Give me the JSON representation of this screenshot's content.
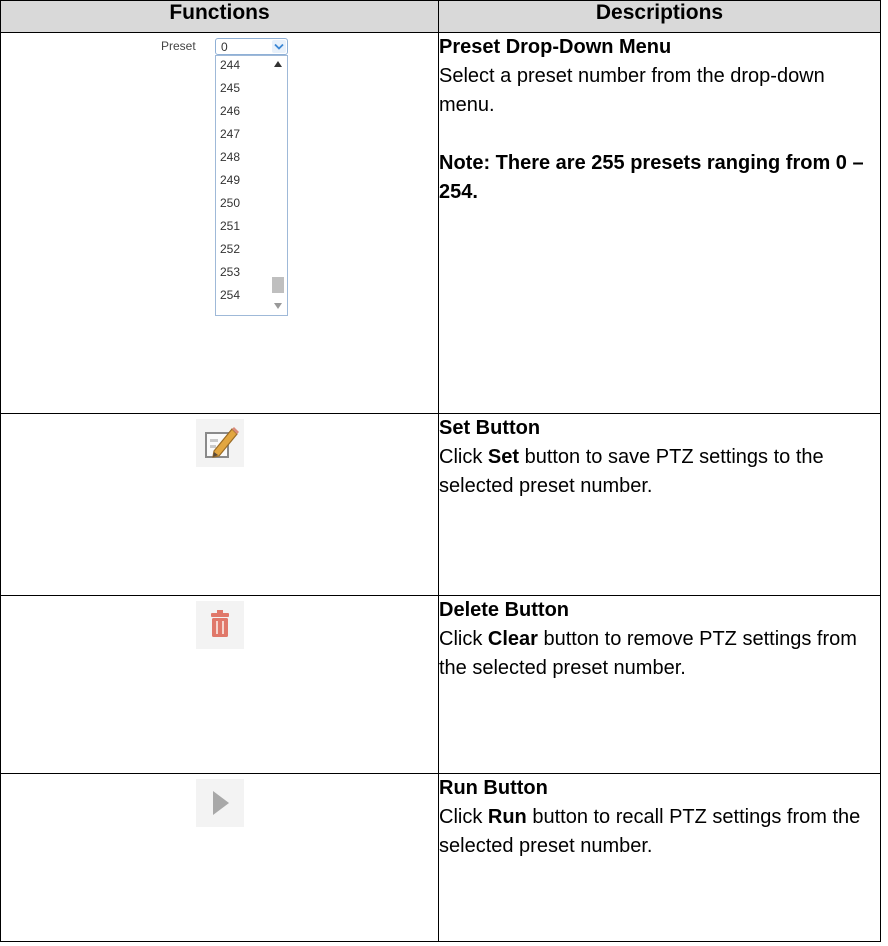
{
  "table": {
    "header_functions": "Functions",
    "header_descriptions": "Descriptions"
  },
  "dropdown": {
    "label": "Preset",
    "selected_value": "0",
    "options": [
      "244",
      "245",
      "246",
      "247",
      "248",
      "249",
      "250",
      "251",
      "252",
      "253",
      "254"
    ]
  },
  "rows": {
    "preset": {
      "title": "Preset Drop-Down Menu",
      "text": "Select a preset number from the drop-down menu.",
      "note": "Note: There are 255 presets ranging from 0 – 254."
    },
    "set": {
      "icon": "pencil-edit-icon",
      "title": "Set Button",
      "text_pre": "Click ",
      "text_bold": "Set",
      "text_post": " button to save PTZ settings to the selected preset number."
    },
    "delete": {
      "icon": "trash-icon",
      "title": "Delete Button",
      "text_pre": "Click ",
      "text_bold": "Clear",
      "text_post": " button to remove PTZ settings from the selected preset number."
    },
    "run": {
      "icon": "play-icon",
      "title": "Run Button",
      "text_pre": "Click ",
      "text_bold": "Run",
      "text_post": " button to recall PTZ settings from the selected preset number."
    }
  },
  "colors": {
    "header_bg": "#d9d9d9",
    "delete_icon": "#e0786a",
    "play_icon": "#a8a8a8"
  }
}
